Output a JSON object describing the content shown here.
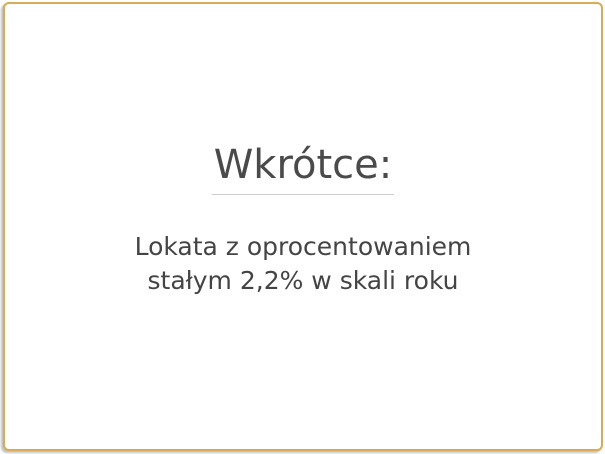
{
  "heading": "Wkrótce:",
  "description_line1": "Lokata z oprocentowaniem",
  "description_line2": "stałym 2,2% w skali roku",
  "colors": {
    "border": "#d9ab55",
    "text": "#4a4a4a"
  }
}
